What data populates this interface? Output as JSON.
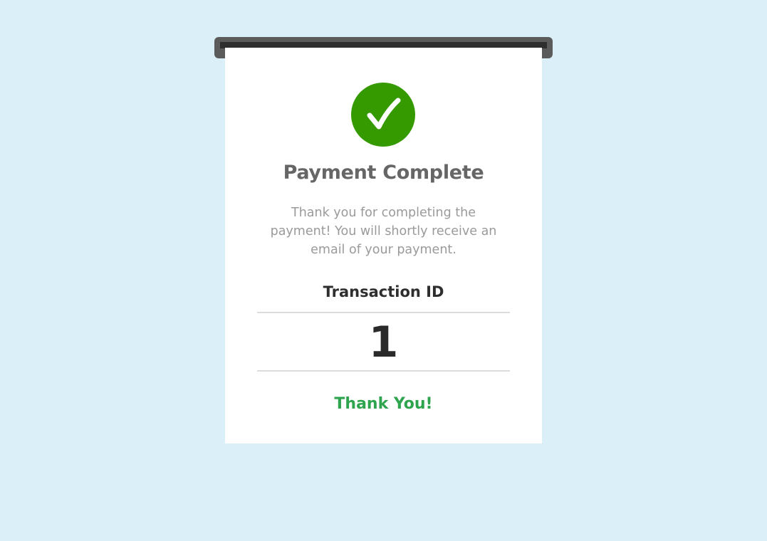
{
  "receipt": {
    "icon": "check-circle-icon",
    "title": "Payment Complete",
    "message": "Thank you for completing the payment! You will shortly receive an email of your payment.",
    "transaction_label": "Transaction ID",
    "transaction_id": "1",
    "thank_you": "Thank You!"
  },
  "colors": {
    "background": "#dbeff8",
    "success_green": "#359a00",
    "thank_you_green": "#2ea44f",
    "printer_slot": "#5b5b5b"
  }
}
